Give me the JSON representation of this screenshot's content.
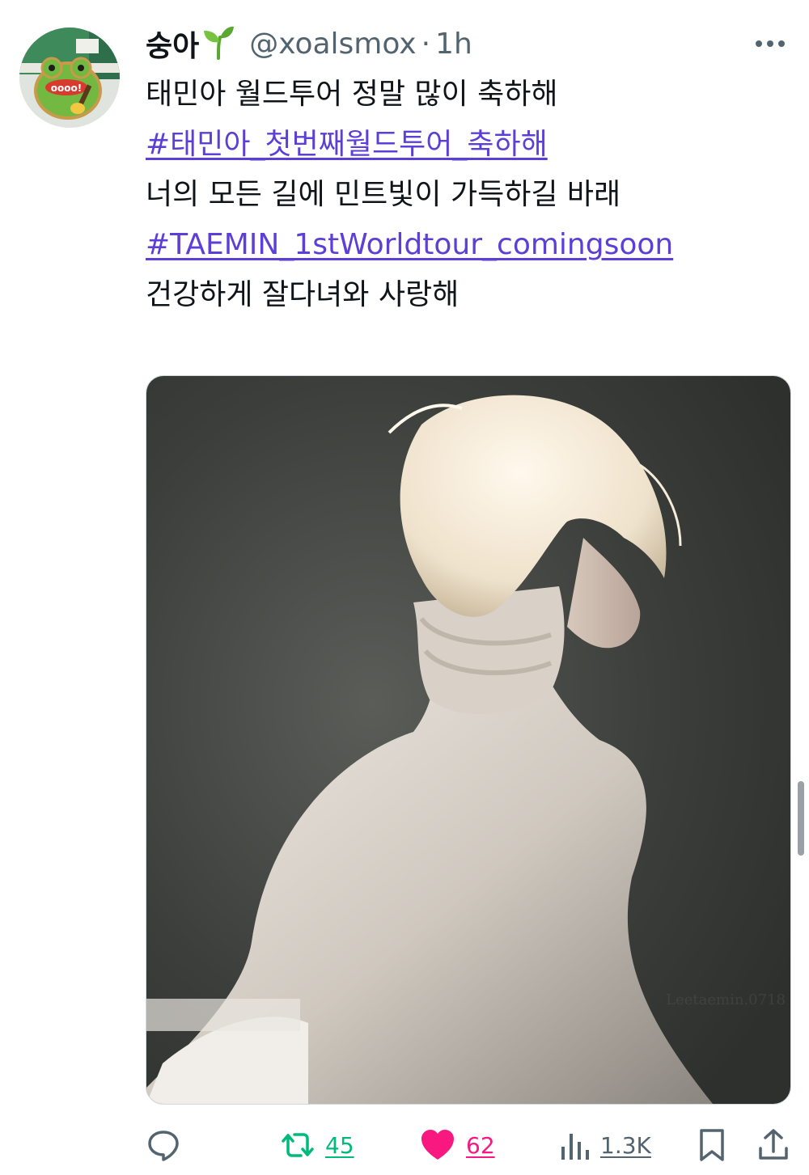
{
  "tweet": {
    "author": {
      "display_name": "숭아",
      "handle": "@xoalsmox",
      "separator": "·",
      "time": "1h"
    },
    "text_lines": [
      {
        "text": "태민아 월드투어 정말 많이 축하해",
        "type": "text"
      },
      {
        "text": "#태민아_첫번째월드투어_축하해",
        "type": "hashtag"
      },
      {
        "text": "너의 모든 길에 민트빛이 가득하길 바래",
        "type": "text"
      },
      {
        "text": "#TAEMIN_1stWorldtour_comingsoon",
        "type": "hashtag"
      },
      {
        "text": "건강하게 잘다녀와 사랑해",
        "type": "text"
      }
    ],
    "photo": {
      "watermark": "Leetaemin.0718"
    },
    "actions": {
      "reply": {
        "icon": "reply-icon"
      },
      "retweet": {
        "icon": "retweet-icon",
        "count": "45",
        "color": "#00ba7c"
      },
      "like": {
        "icon": "heart-icon",
        "count": "62",
        "color": "#f91880"
      },
      "views": {
        "icon": "views-icon",
        "count": "1.3K"
      },
      "bookmark": {
        "icon": "bookmark-icon"
      },
      "share": {
        "icon": "share-icon"
      }
    },
    "colors": {
      "hashtag": "#5b3fd6",
      "text": "#0f1419",
      "secondary": "#536471"
    }
  }
}
